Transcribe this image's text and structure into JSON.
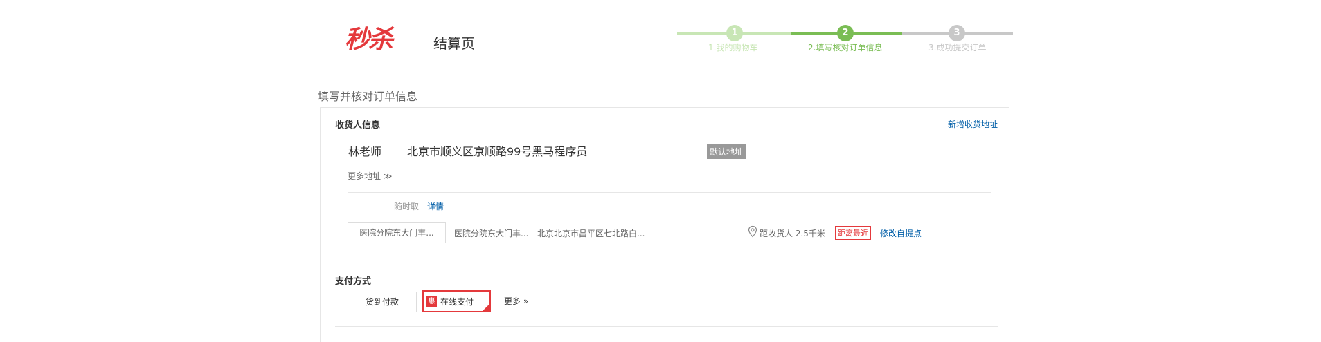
{
  "header": {
    "logo_text": "秒杀",
    "page_name": "结算页"
  },
  "steps": [
    {
      "num": "1",
      "label": "1.我的购物车",
      "color": "#c8e6b5"
    },
    {
      "num": "2",
      "label": "2.填写核对订单信息",
      "color": "#7abd54"
    },
    {
      "num": "3",
      "label": "3.成功提交订单",
      "color": "#c8c8c8"
    }
  ],
  "section_heading": "填写并核对订单信息",
  "receiver": {
    "title": "收货人信息",
    "add_link": "新增收货地址",
    "name": "林老师",
    "address": "北京市顺义区京顺路99号黑马程序员",
    "default_badge": "默认地址",
    "more_addresses": "更多地址 ≫"
  },
  "pickup": {
    "anytime": "随时取",
    "detail_link": "详情",
    "selected_point": "医院分院东大门丰...",
    "point_name": "医院分院东大门丰...",
    "point_address": "北京北京市昌平区七北路白...",
    "distance": "距收货人 2.5千米",
    "nearest_tag": "距离最近",
    "modify_link": "修改自提点"
  },
  "payment": {
    "title": "支付方式",
    "cod": "货到付款",
    "online_badge": "惠",
    "online": "在线支付",
    "more": "更多 »"
  },
  "colors": {
    "accent_red": "#e4393c",
    "link_blue": "#005ea7"
  }
}
